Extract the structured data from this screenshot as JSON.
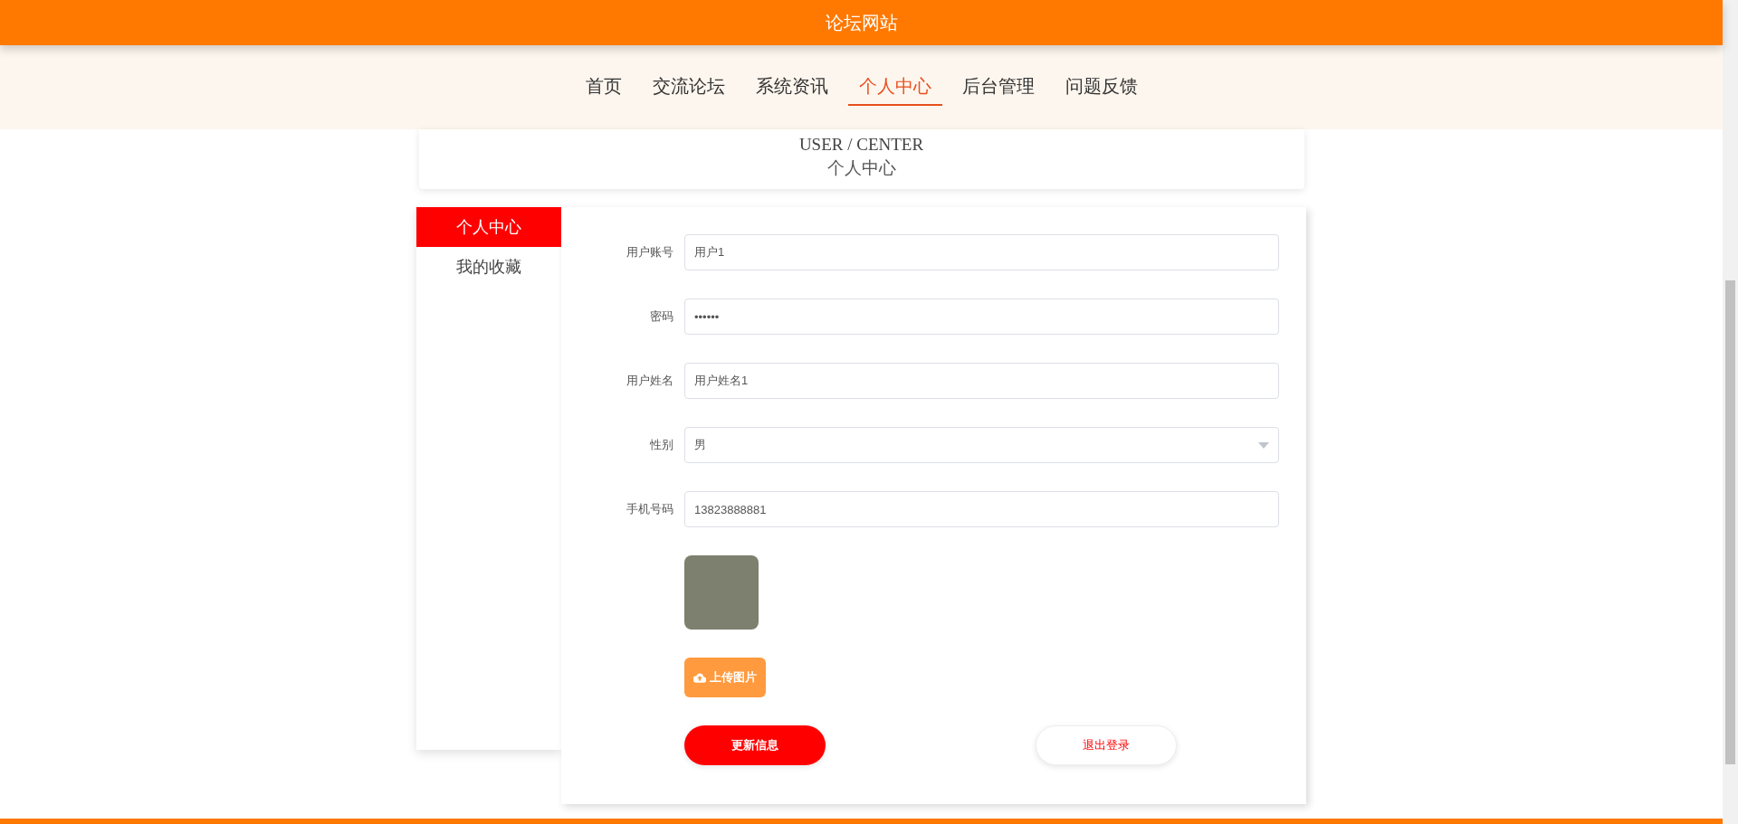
{
  "site_title": "论坛网站",
  "nav": [
    {
      "label": "首页",
      "selected": false
    },
    {
      "label": "交流论坛",
      "selected": false
    },
    {
      "label": "系统资讯",
      "selected": false
    },
    {
      "label": "个人中心",
      "selected": true
    },
    {
      "label": "后台管理",
      "selected": false
    },
    {
      "label": "问题反馈",
      "selected": false
    }
  ],
  "page_heading": {
    "title": "USER / CENTER",
    "subtitle": "个人中心"
  },
  "sidebar": [
    {
      "label": "个人中心",
      "selected": true
    },
    {
      "label": "我的收藏",
      "selected": false
    }
  ],
  "form": [
    {
      "label": "用户账号",
      "kind": "text",
      "value": "用户1"
    },
    {
      "label": "密码",
      "kind": "password",
      "value": "••••••"
    },
    {
      "label": "用户姓名",
      "kind": "text",
      "value": "用户姓名1"
    },
    {
      "label": "性别",
      "kind": "select",
      "value": "男"
    },
    {
      "label": "手机号码",
      "kind": "text",
      "value": "13823888881"
    }
  ],
  "upload_button": "上传图片",
  "buttons": [
    {
      "label": "更新信息",
      "kind": "primary"
    },
    {
      "label": "退出登录",
      "kind": "secondary"
    }
  ]
}
